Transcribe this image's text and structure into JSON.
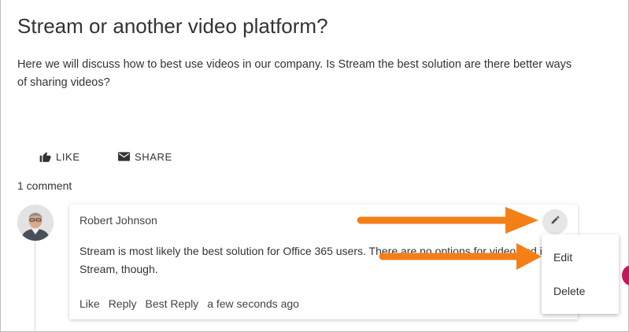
{
  "post": {
    "title": "Stream or another video platform?",
    "description": "Here we will discuss how to best use videos in our company. Is Stream the best solution are there better ways of sharing videos?"
  },
  "actions": {
    "like_label": "LIKE",
    "like_icon": "thumbs-up-icon",
    "share_label": "SHARE",
    "share_icon": "envelope-icon"
  },
  "comments": {
    "count_label": "1 comment",
    "items": [
      {
        "author": "Robert Johnson",
        "text": "Stream is most likely the best solution for Office 365 users. There are no options for videos ed in Stream, though.",
        "like_label": "Like",
        "reply_label": "Reply",
        "best_reply_label": "Best Reply",
        "timestamp": "a few seconds ago",
        "edit_icon": "pencil-icon"
      }
    ]
  },
  "context_menu": {
    "edit_label": "Edit",
    "delete_label": "Delete"
  },
  "colors": {
    "annotation_arrow": "#f57f17",
    "accent_blob": "#c2185b"
  }
}
